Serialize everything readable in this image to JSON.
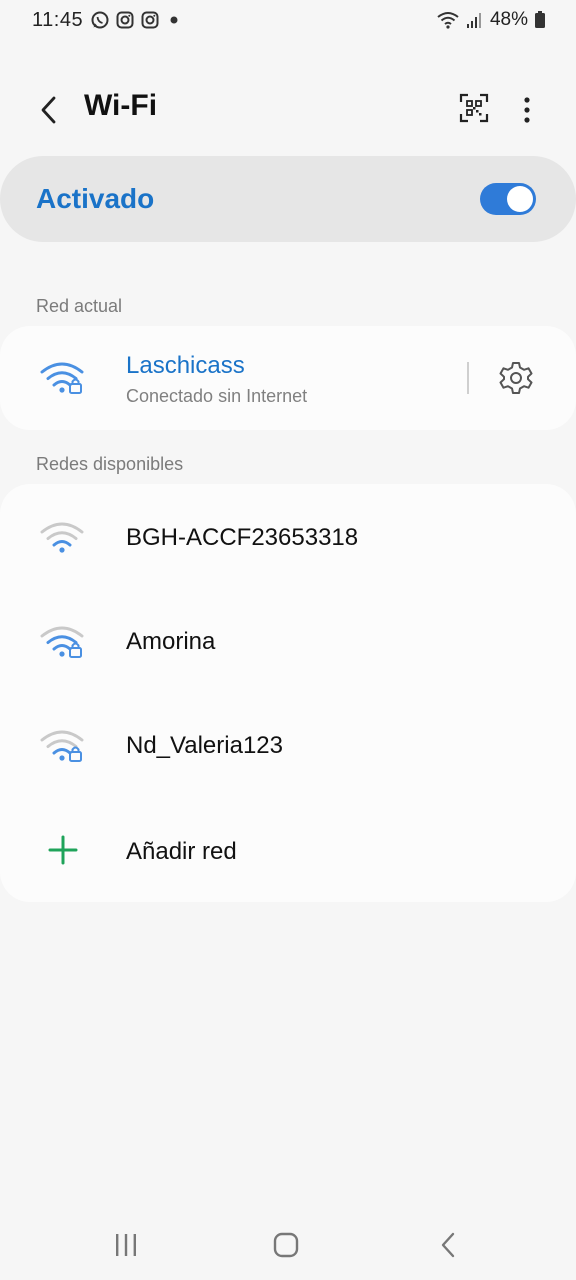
{
  "status_bar": {
    "time": "11:45",
    "left_icons": [
      "whatsapp-icon",
      "instagram-icon",
      "instagram-icon",
      "notification-dot-icon"
    ],
    "battery": "48%",
    "right_icons": [
      "wifi-icon",
      "signal-icon",
      "battery-icon"
    ]
  },
  "header": {
    "title": "Wi-Fi",
    "back_icon": "back-arrow-icon",
    "qr_icon": "qr-code-icon",
    "more_icon": "more-vertical-icon"
  },
  "master": {
    "label": "Activado",
    "enabled": true
  },
  "current_section": {
    "title": "Red actual",
    "network": {
      "name": "Laschicass",
      "status": "Conectado sin Internet",
      "secured": true
    }
  },
  "available_section": {
    "title": "Redes disponibles",
    "networks": [
      {
        "name": "BGH-ACCF23653318",
        "secured": false
      },
      {
        "name": "Amorina",
        "secured": true
      },
      {
        "name": "Nd_Valeria123",
        "secured": true
      }
    ],
    "add_label": "Añadir red"
  },
  "nav_bar": {
    "icons": [
      "recent-apps-icon",
      "home-icon",
      "back-icon"
    ]
  },
  "colors": {
    "accent": "#1a73c8",
    "toggle": "#2f7bd8",
    "add_icon": "#1fa35a",
    "background": "#f6f6f6"
  }
}
